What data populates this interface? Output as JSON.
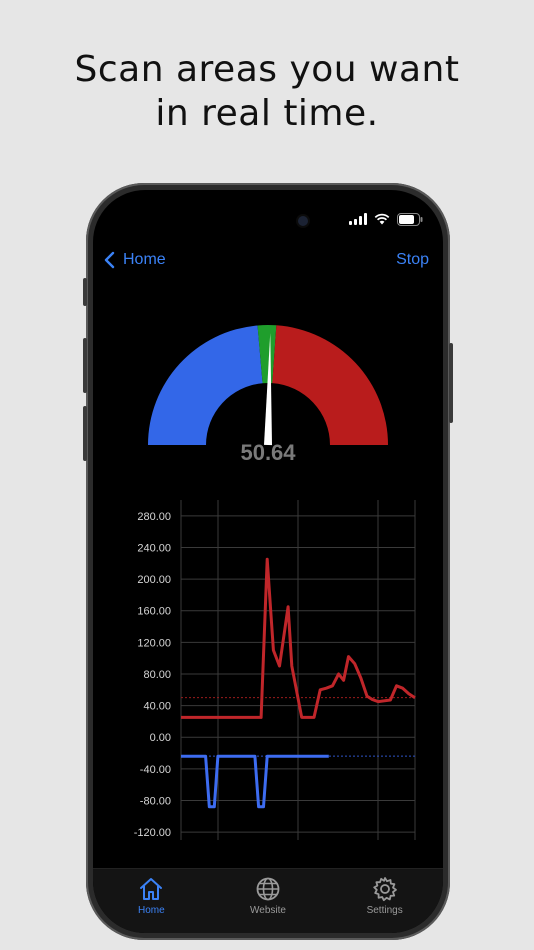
{
  "headline": {
    "line1": "Scan areas you want",
    "line2": "in real time."
  },
  "nav": {
    "back_label": "Home",
    "action_label": "Stop"
  },
  "gauge": {
    "value": 50.64,
    "display": "50.64"
  },
  "colors": {
    "accent": "#3b82f6",
    "blue": "#3367e8",
    "green": "#1f9e2c",
    "red": "#b91c1c"
  },
  "chart_data": {
    "type": "line",
    "yticks": [
      "280.00",
      "240.00",
      "200.00",
      "160.00",
      "120.00",
      "80.00",
      "40.00",
      "0.00",
      "-40.00",
      "-80.00",
      "-120.00"
    ],
    "ylim": [
      -130,
      300
    ],
    "grid": true,
    "thresholds": [
      50,
      -24
    ],
    "series": [
      {
        "color": "#c0262a",
        "x": [
          0,
          4,
          6,
          6.5,
          7,
          7.5,
          8,
          8.7,
          9,
          9.8,
          10.2,
          10.8,
          11.3,
          11.8,
          12.3,
          12.8,
          13.2,
          13.6,
          14.1,
          14.6,
          15.1,
          15.5,
          16,
          17,
          17.5,
          18,
          18.5,
          19
        ],
        "values": [
          25,
          25,
          25,
          25,
          225,
          110,
          90,
          165,
          90,
          25,
          25,
          25,
          60,
          62,
          65,
          80,
          72,
          102,
          93,
          75,
          52,
          48,
          45,
          47,
          65,
          62,
          55,
          50
        ]
      },
      {
        "color": "#3d6cf0",
        "x": [
          0,
          2,
          2.3,
          2.7,
          3,
          6,
          6.3,
          6.7,
          7,
          12
        ],
        "values": [
          -24,
          -24,
          -88,
          -88,
          -24,
          -24,
          -88,
          -88,
          -24,
          -24
        ]
      }
    ]
  },
  "tabs": [
    {
      "label": "Home",
      "icon": "house-icon",
      "active": true
    },
    {
      "label": "Website",
      "icon": "globe-icon",
      "active": false
    },
    {
      "label": "Settings",
      "icon": "gear-icon",
      "active": false
    }
  ]
}
